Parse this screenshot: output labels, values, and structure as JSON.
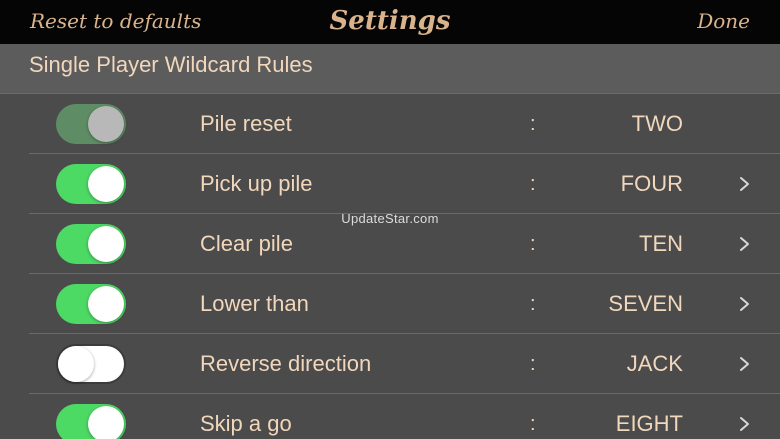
{
  "nav": {
    "left_label": "Reset to defaults",
    "title": "Settings",
    "right_label": "Done"
  },
  "section": {
    "title": "Single Player Wildcard Rules"
  },
  "rules": [
    {
      "label": "Pile reset",
      "value": "TWO",
      "enabled": true,
      "dimmed": true,
      "has_chevron": false
    },
    {
      "label": "Pick up pile",
      "value": "FOUR",
      "enabled": true,
      "dimmed": false,
      "has_chevron": true
    },
    {
      "label": "Clear pile",
      "value": "TEN",
      "enabled": true,
      "dimmed": false,
      "has_chevron": true
    },
    {
      "label": "Lower than",
      "value": "SEVEN",
      "enabled": true,
      "dimmed": false,
      "has_chevron": true
    },
    {
      "label": "Reverse direction",
      "value": "JACK",
      "enabled": false,
      "dimmed": false,
      "has_chevron": true
    },
    {
      "label": "Skip a go",
      "value": "EIGHT",
      "enabled": true,
      "dimmed": false,
      "has_chevron": true
    }
  ],
  "separator": ":",
  "watermark": "UpdateStar.com",
  "colors": {
    "toggle_on": "#4cd964",
    "text": "#f1d7bc",
    "nav_text": "#d9b38c",
    "background": "#4b4b4b"
  }
}
